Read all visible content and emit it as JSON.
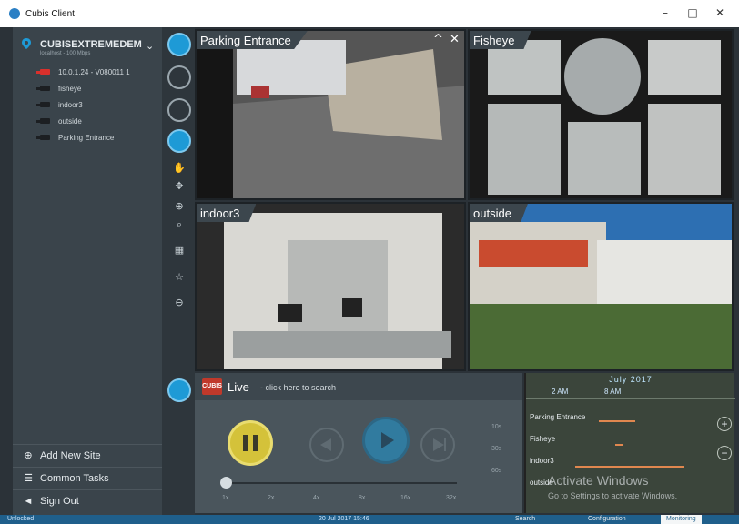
{
  "window": {
    "title": "Cubis Client",
    "controls": [
      "–",
      "□",
      "✕"
    ]
  },
  "sidebar": {
    "site_name": "CUBISEXTREMEDEM",
    "site_sub": "localhost - 100 Mbps",
    "cameras": [
      {
        "label": "10.0.1.24 - V080011 1",
        "color": "#d9302c"
      },
      {
        "label": "fisheye",
        "color": "#222222"
      },
      {
        "label": "indoor3",
        "color": "#222222"
      },
      {
        "label": "outside",
        "color": "#222222"
      },
      {
        "label": "Parking Entrance",
        "color": "#222222"
      }
    ],
    "bottom": {
      "add_site": "Add New Site",
      "common_tasks": "Common Tasks",
      "sign_out": "Sign Out"
    }
  },
  "tiles": {
    "parking": "Parking Entrance",
    "fisheye": "Fisheye",
    "indoor": "indoor3",
    "outside": "outside"
  },
  "live": {
    "label": "Live",
    "hint": "- click here to search",
    "logo": "CUBIS",
    "speeds": [
      "1x",
      "2x",
      "4x",
      "8x",
      "16x",
      "32x"
    ],
    "jumps": [
      "10s",
      "30s",
      "60s"
    ]
  },
  "timeline": {
    "month": "July 2017",
    "times": [
      "2 AM",
      "8 AM"
    ],
    "rows": [
      "Parking Entrance",
      "Fisheye",
      "indoor3",
      "outside"
    ]
  },
  "watermark": {
    "line1": "Activate Windows",
    "line2": "Go to Settings to activate Windows."
  },
  "statusbar": {
    "left": "Unlocked",
    "center": "20 Jul 2017 15:46",
    "tabs": [
      "Search",
      "Configuration",
      "Monitoring"
    ]
  },
  "colors": {
    "accent": "#1e9ad6",
    "sidebar": "#3a444b",
    "pause": "#d4c23a",
    "play": "#1e9ad6",
    "timeline_bar": "#e0874f"
  }
}
